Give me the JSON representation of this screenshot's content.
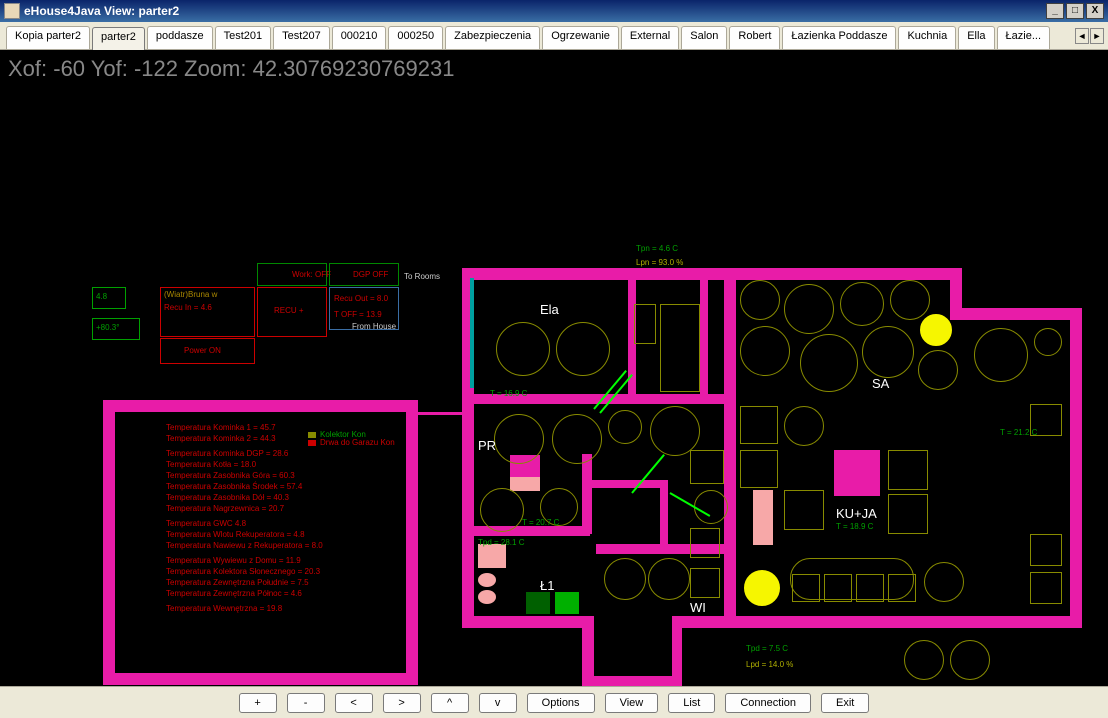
{
  "window": {
    "title": "eHouse4Java View:   parter2"
  },
  "tabs": [
    "Kopia parter2",
    "parter2",
    "poddasze",
    "Test201",
    "Test207",
    "000210",
    "000250",
    "Zabezpieczenia",
    "Ogrzewanie",
    "External",
    "Salon",
    "Robert",
    "Łazienka Poddasze",
    "Kuchnia",
    "Ella",
    "Łazie..."
  ],
  "active_tab_index": 1,
  "status_line": "Xof: -60 Yof: -122 Zoom: 42.30769230769231",
  "bottom_buttons": [
    "+",
    "-",
    "<",
    ">",
    "^",
    "v",
    "Options",
    "View",
    "List",
    "Connection",
    "Exit"
  ],
  "rooms": {
    "ela": "Ela",
    "sa": "SA",
    "pr": "PR",
    "ku_ja": "KU+JA",
    "l1": "Ł1",
    "wi": "WI"
  },
  "temp_labels": {
    "top": "Tpn = 4.6 C",
    "lpn": "Lpn = 93.0 %",
    "t_ela": "T = 16.9 C",
    "t_sa": "T = 21.2 C",
    "t_pr": "T = 20.7 C",
    "t_kuja": "T = 18.9 C",
    "tpd_l1": "Tpd = 28.1 C",
    "tpd_bottom": "Tpd = 7.5 C",
    "lpd_bottom": "Lpd = 14.0 %"
  },
  "side_boxes": {
    "val_48": "4.8",
    "val_803": "+80.3°",
    "wiat_bruna": "(Wiatr)Bruna w",
    "recu_in": "Recu In = 4.6",
    "work_off": "Work: OFF",
    "power_on": "Power ON",
    "recu_plus": "RECU +",
    "dgp_off": "DGP OFF",
    "recu_out": "Recu Out = 8.0",
    "t_off": "T OFF = 13.9",
    "to_rooms": "To Rooms",
    "from_house": "From House"
  },
  "legend": {
    "l1": "Kolektor Kon",
    "l2": "Drwa do Garazu Kon"
  },
  "sensor_list": [
    "Temperatura Kominka 1 = 45.7",
    "Temperatura Kominka 2 = 44.3",
    "Temperatura Kominka DGP = 28.6",
    "Temperatura Kotła = 18.0",
    "Temperatura Zasobnika Góra = 60.3",
    "Temperatura Zasobnika Środek = 57.4",
    "Temperatura Zasobnika Dół = 40.3",
    "Temperatura Nagrzewnica = 20.7",
    "Temperatura GWC 4.8",
    "Temperatura Wlotu Rekuperatora = 4.8",
    "Temperatura Nawiewu z Rekuperatora = 8.0",
    "Temperatura Wywiewu z Domu = 11.9",
    "Temperatura Kolektora Słonecznego = 20.3",
    "Temperatura Zewnętrzna Południe = 7.5",
    "Temperatura Zewnętrzna Północ = 4.6",
    "Temperatura Wewnętrzna = 19.8"
  ]
}
